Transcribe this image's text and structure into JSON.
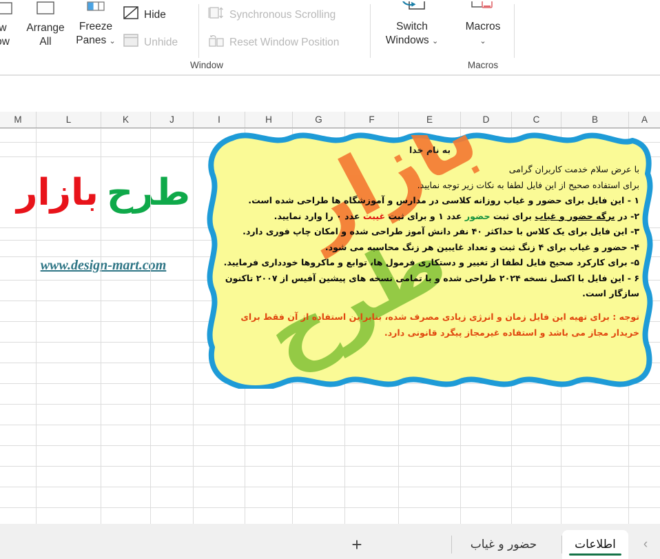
{
  "ribbon": {
    "groups": [
      {
        "label": "Window"
      },
      {
        "label": "Macros"
      }
    ],
    "buttons": {
      "new_window_line1": "w",
      "new_window_line2": "ow",
      "arrange_all_line1": "Arrange",
      "arrange_all_line2": "All",
      "freeze_panes_line1": "Freeze",
      "freeze_panes_line2": "Panes",
      "freeze_chevron": "⌄",
      "hide": "Hide",
      "unhide": "Unhide",
      "synchronous_scrolling": "Synchronous Scrolling",
      "reset_window_position": "Reset Window Position",
      "switch_windows_line1": "Switch",
      "switch_windows_line2": "Windows",
      "switch_chevron": "⌄",
      "macros": "Macros",
      "macros_chevron": "⌄"
    },
    "icons": {
      "new_window": "new-window-icon",
      "arrange_all": "arrange-all-icon",
      "freeze_panes": "freeze-panes-icon",
      "hide": "hide-window-icon",
      "unhide": "unhide-window-icon",
      "synchronous_scrolling": "synchronous-scrolling-icon",
      "reset_window_position": "reset-window-position-icon",
      "switch_windows": "switch-windows-icon",
      "macros": "macros-icon"
    }
  },
  "sheet": {
    "column_headers": [
      "M",
      "L",
      "K",
      "J",
      "I",
      "H",
      "G",
      "F",
      "E",
      "D",
      "C",
      "B",
      "A"
    ],
    "logo": {
      "word_green": "طرح",
      "word_red": "بازار",
      "url": "www.design-mart.com"
    },
    "watermark": {
      "top": "بازار",
      "bottom": "طرح",
      "color_top": "#F47B33",
      "color_bottom": "#8CC63F"
    }
  },
  "callout": {
    "fill_color": "#FAFA96",
    "border_color": "#1E9BD7",
    "header": "به نام خدا",
    "line_greeting": "با عرض سلام خدمت کاربران گرامی",
    "line_intro": "برای استفاده صحیح از این فایل لطفا به نکات زیر توجه نمایید.",
    "item1": "۱ - این فایل برای حضور و غیاب روزانه کلاسی در مدارس و آموزشگاه ها طراحی شده است.",
    "item2_a": "۲- در ",
    "item2_b_underline": "برگه حضور و غیاب",
    "item2_c": " برای ثبت ",
    "item2_hozoor": "حضور",
    "item2_d": " عدد ۱ و برای ثبت ",
    "item2_gheybat": "غیبت",
    "item2_e": " عدد ۰ را وارد نمایید.",
    "item3": "۳- این فایل برای یک کلاس با حداکثر ۴۰ نفر دانش آموز طراحی شده و امکان چاپ فوری دارد.",
    "item4": "۴- حضور و غیاب برای ۴ زنگ ثبت و تعداد غایبین هر زنگ محاسبه می شود.",
    "item5": "۵- برای کارکرد صحیح فایل لطفا از تغییر و دستکاری فرمول ها، توابع و ماکروها خودداری فرمایید.",
    "item6": "۶ - این فایل با اکسل نسخه ۲۰۲۴ طراحی شده و با تمامی نسخه های پیشین آفیس از ۲۰۰۷ تاکنون",
    "item6_cont": "سازگار است.",
    "note": "توجه : برای تهیه این فایل زمان و انرژی زیادی مصرف شده، بنابراین استفاده از آن فقط برای خریدار مجاز می باشد و استفاده غیرمجاز پیگرد قانونی دارد."
  },
  "tabbar": {
    "active_tab": "اطلاعات",
    "second_tab": "حضور و غیاب",
    "add_sheet": "+",
    "nav_prev": "‹",
    "active_underline_color": "#157347"
  }
}
